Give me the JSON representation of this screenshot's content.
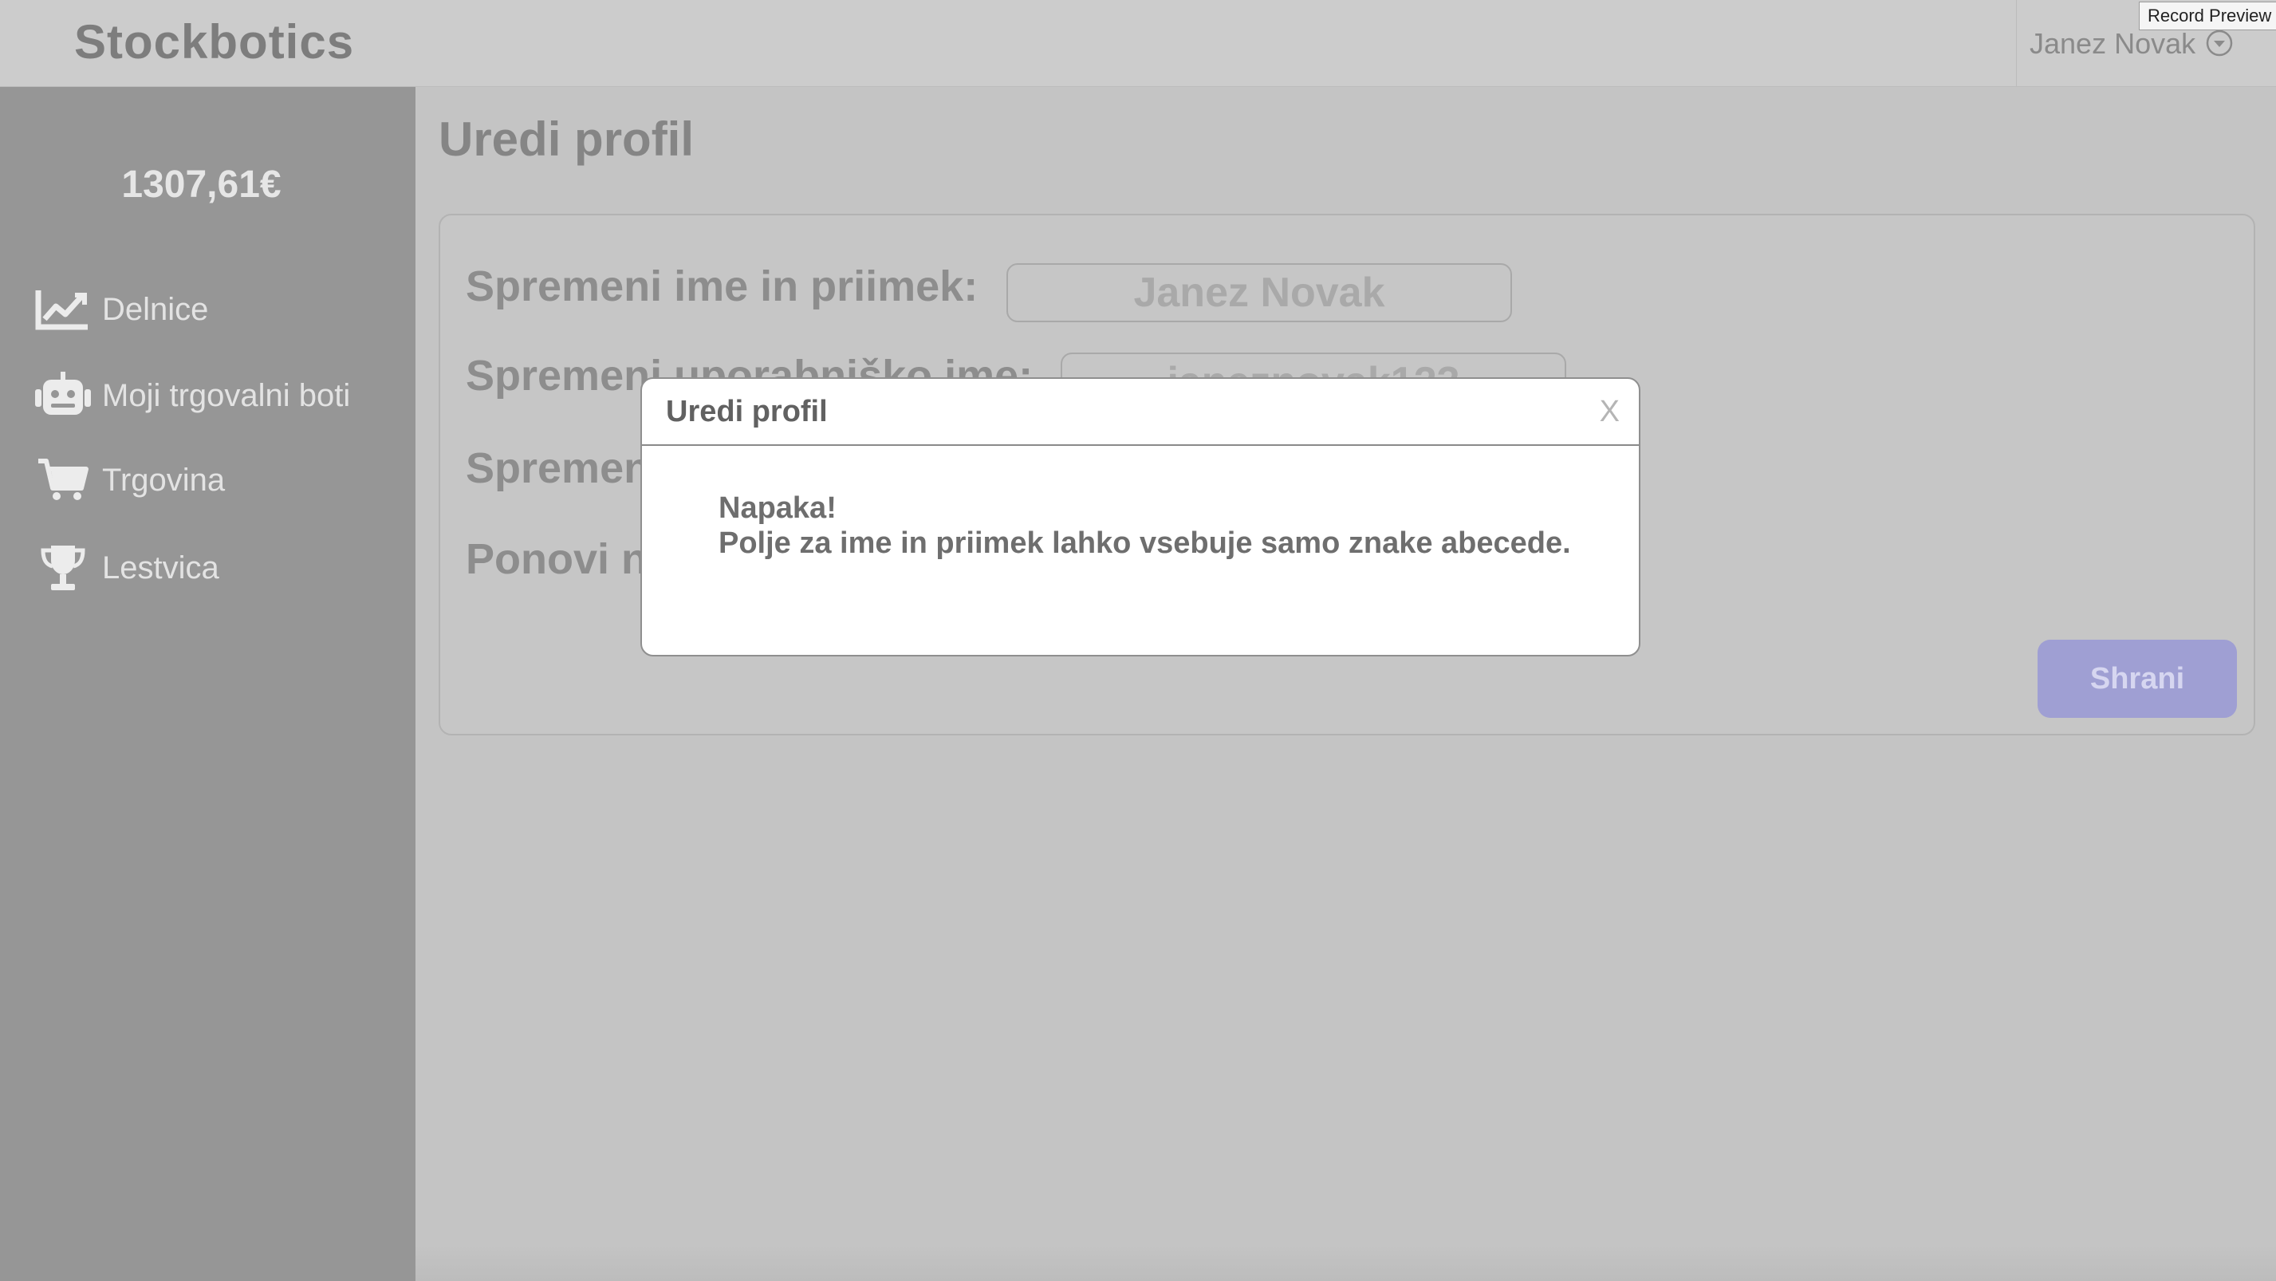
{
  "app": {
    "logo": "Stockbotics",
    "user_name": "Janez Novak",
    "tooltip": "Record Preview"
  },
  "sidebar": {
    "balance": "1307,61€",
    "items": [
      {
        "label": "Delnice",
        "icon": "chart-line-icon"
      },
      {
        "label": "Moji trgovalni boti",
        "icon": "robot-icon"
      },
      {
        "label": "Trgovina",
        "icon": "shopping-cart-icon"
      },
      {
        "label": "Lestvica",
        "icon": "trophy-icon"
      }
    ]
  },
  "main": {
    "title": "Uredi profil",
    "form": {
      "name_label": "Spremeni ime in priimek:",
      "name_value": "Janez Novak",
      "username_label": "Spremeni uporabniško ime:",
      "username_value": "janeznovak123",
      "password_label": "Spremeni geslo:",
      "repeat_label": "Ponovi novo geslo:",
      "save_label": "Shrani"
    }
  },
  "modal": {
    "title": "Uredi profil",
    "close_label": "X",
    "message_line1": "Napaka!",
    "message_line2": "Polje za ime in priimek lahko vsebuje samo znake abecede."
  },
  "colors": {
    "sidebar_bg": "#969696",
    "page_bg": "#c4c4c4",
    "accent_button": "#9f9fd3"
  }
}
